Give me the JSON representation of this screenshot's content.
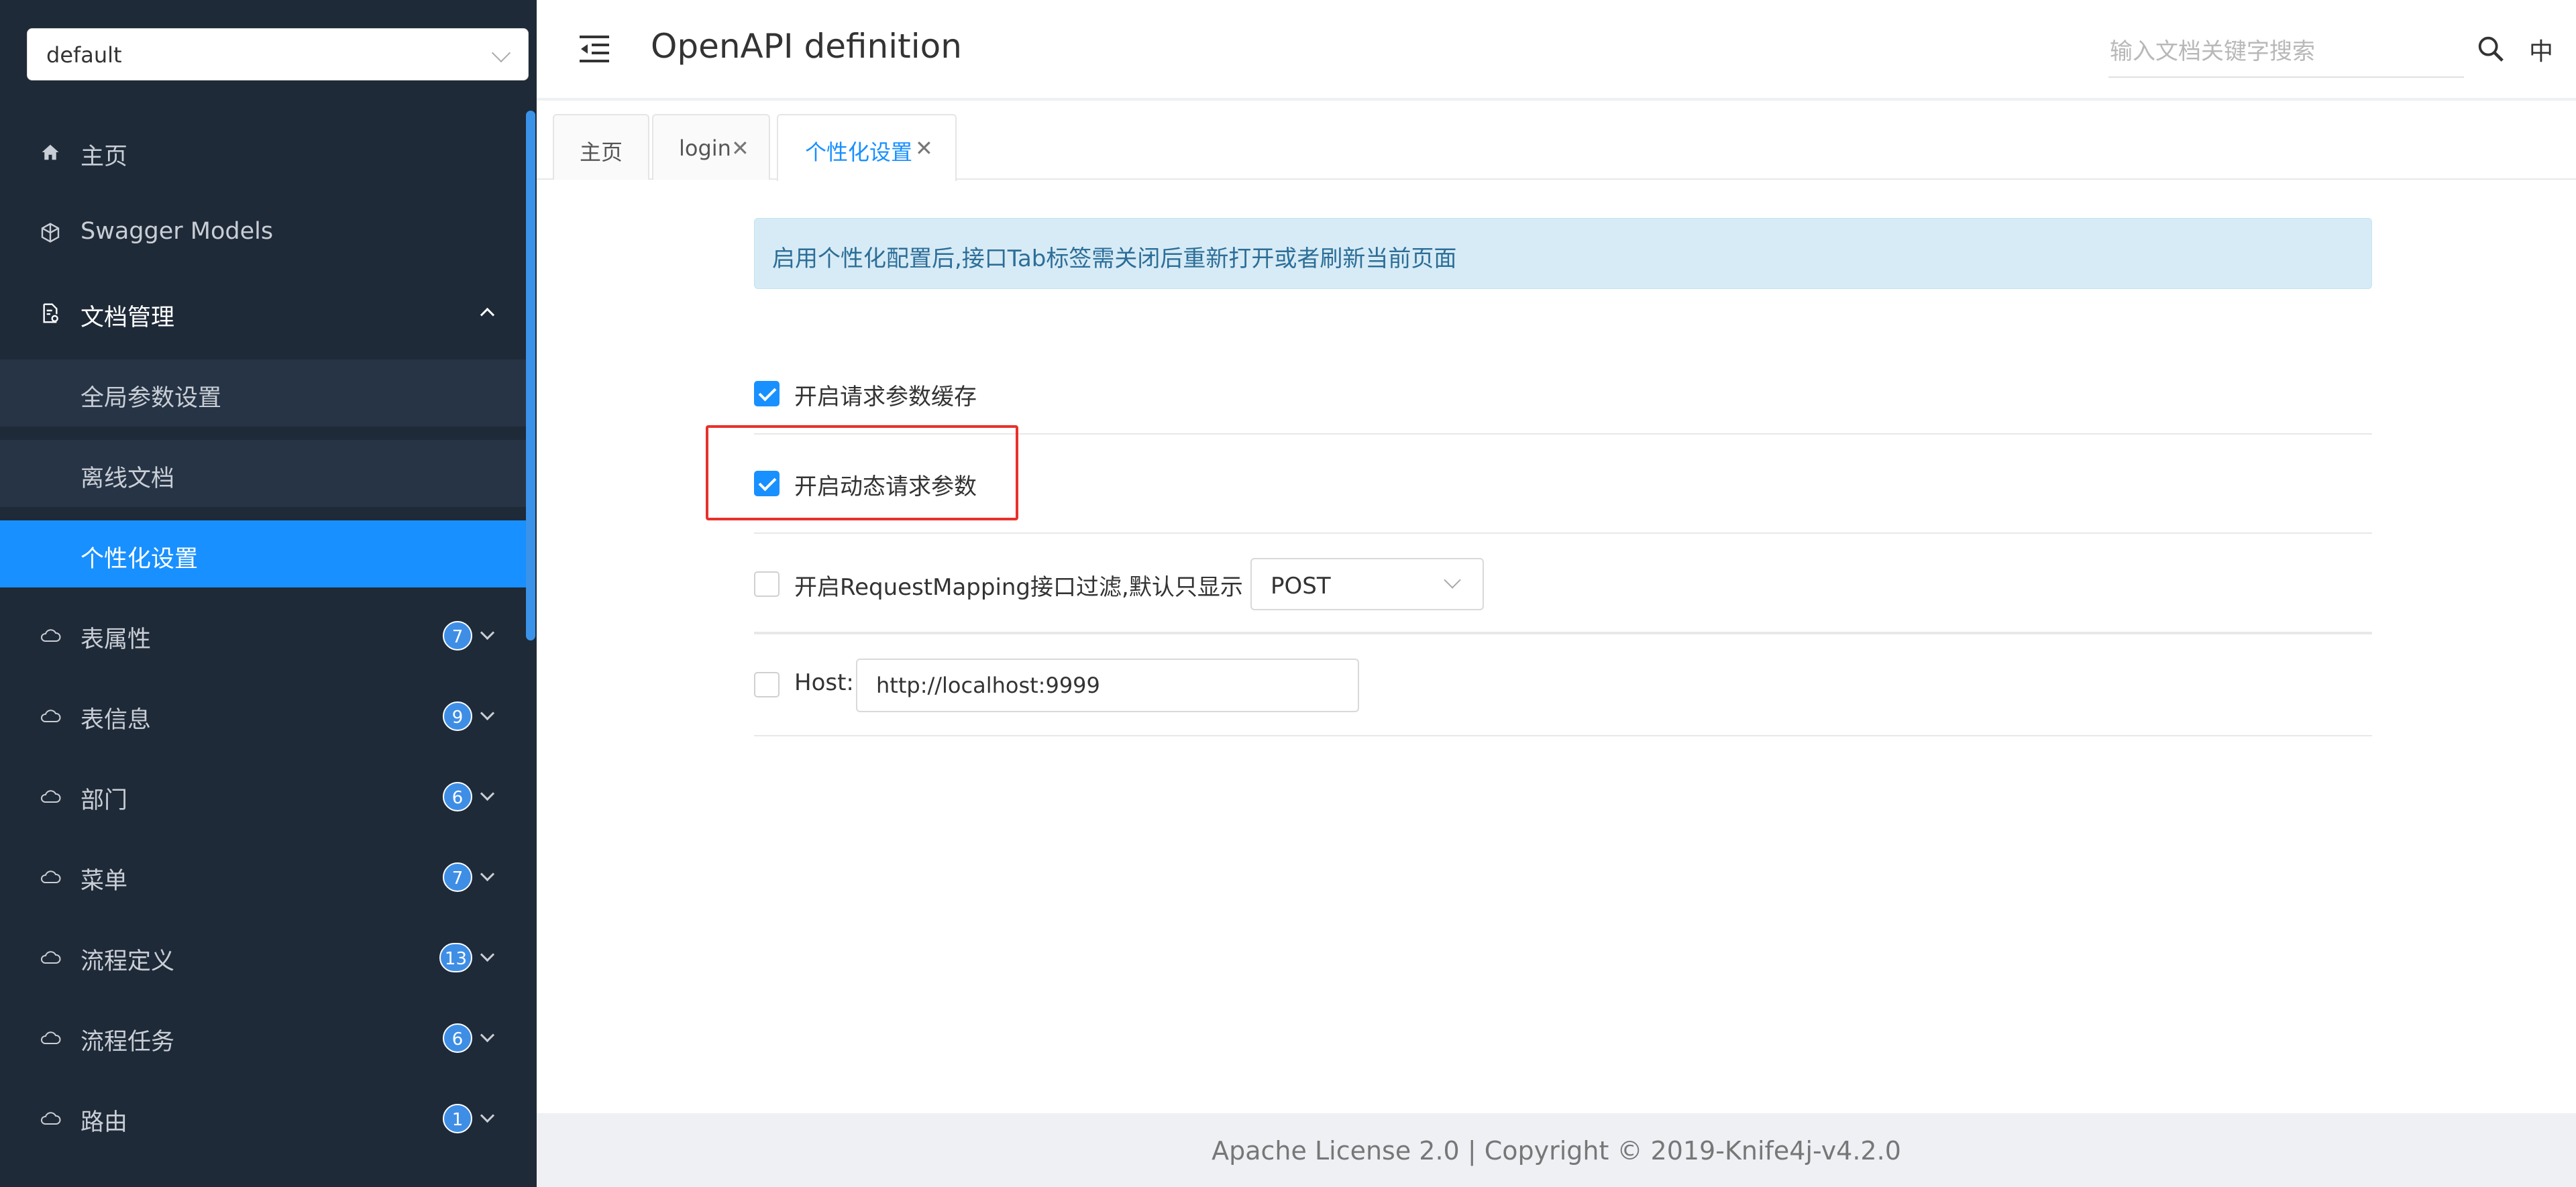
{
  "sidebar": {
    "group_select": "default",
    "items": [
      {
        "label": "主页",
        "icon": "home-icon"
      },
      {
        "label": "Swagger Models",
        "icon": "cube-icon"
      },
      {
        "label": "文档管理",
        "icon": "document-settings-icon"
      },
      {
        "label": "全局参数设置"
      },
      {
        "label": "离线文档"
      },
      {
        "label": "个性化设置"
      },
      {
        "label": "表属性",
        "icon": "cloud-icon",
        "badge": "7"
      },
      {
        "label": "表信息",
        "icon": "cloud-icon",
        "badge": "9"
      },
      {
        "label": "部门",
        "icon": "cloud-icon",
        "badge": "6"
      },
      {
        "label": "菜单",
        "icon": "cloud-icon",
        "badge": "7"
      },
      {
        "label": "流程定义",
        "icon": "cloud-icon",
        "badge": "13"
      },
      {
        "label": "流程任务",
        "icon": "cloud-icon",
        "badge": "6"
      },
      {
        "label": "路由",
        "icon": "cloud-icon",
        "badge": "1"
      }
    ]
  },
  "header": {
    "title": "OpenAPI definition",
    "search_placeholder": "输入文档关键字搜索",
    "lang": "中"
  },
  "tabs": [
    {
      "label": "主页"
    },
    {
      "label": "login"
    },
    {
      "label": "个性化设置"
    }
  ],
  "settings": {
    "notice": "启用个性化配置后,接口Tab标签需关闭后重新打开或者刷新当前页面",
    "cache_label": "开启请求参数缓存",
    "cache_checked": true,
    "dynamic_label": "开启动态请求参数",
    "dynamic_checked": true,
    "filter_label": "开启RequestMapping接口过滤,默认只显示",
    "filter_checked": false,
    "filter_method": "POST",
    "host_label": "Host:",
    "host_checked": false,
    "host_value": "http://localhost:9999"
  },
  "footer": "Apache License 2.0 | Copyright © 2019-Knife4j-v4.2.0",
  "colors": {
    "sidebar_bg": "#1f2a38",
    "accent": "#1890ff",
    "highlight_border": "#e8312b"
  }
}
